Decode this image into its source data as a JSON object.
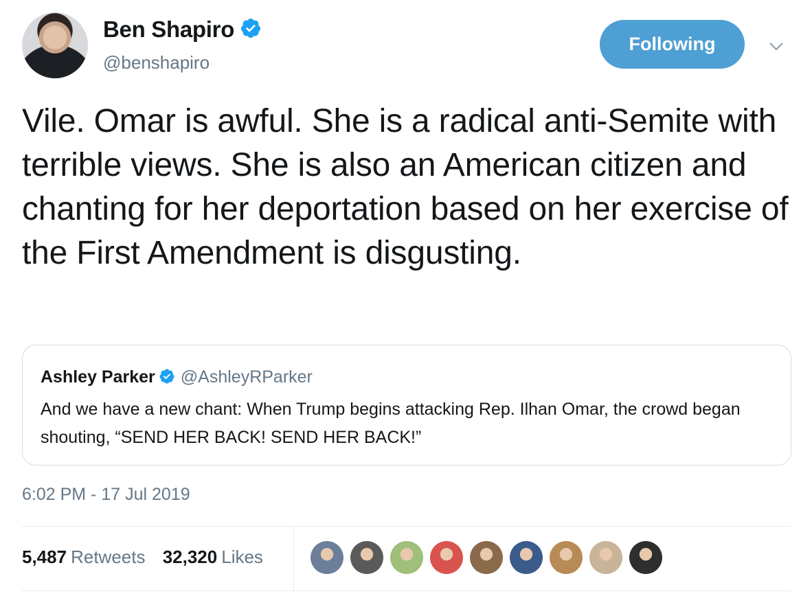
{
  "author": {
    "name": "Ben Shapiro",
    "handle": "@benshapiro",
    "verified": true
  },
  "follow_button": {
    "label": "Following",
    "color": "#4e9fd3"
  },
  "tweet": {
    "text": "Vile. Omar is awful. She is a radical anti-Semite with terrible views. She is also an American citizen and chanting for her deportation based on her exercise of the First Amendment is disgusting."
  },
  "quoted_tweet": {
    "name": "Ashley Parker",
    "handle": "@AshleyRParker",
    "verified": true,
    "text": "And we have a new chant: When Trump begins attacking Rep. Ilhan Omar, the crowd began shouting, “SEND HER BACK! SEND HER BACK!”"
  },
  "timestamp": "6:02 PM - 17 Jul 2019",
  "stats": {
    "retweets_count": "5,487",
    "retweets_label": "Retweets",
    "likes_count": "32,320",
    "likes_label": "Likes"
  },
  "likers": [
    {
      "icon": "avatar",
      "color": "#6b7f9a"
    },
    {
      "icon": "avatar",
      "color": "#5a5a5a"
    },
    {
      "icon": "avatar",
      "color": "#9fbf7a"
    },
    {
      "icon": "avatar",
      "color": "#d9534f"
    },
    {
      "icon": "avatar",
      "color": "#8a6a4a"
    },
    {
      "icon": "avatar",
      "color": "#3b5b8c"
    },
    {
      "icon": "avatar",
      "color": "#b88a55"
    },
    {
      "icon": "avatar",
      "color": "#c9b49a"
    },
    {
      "icon": "avatar",
      "color": "#2e2e2e"
    }
  ],
  "colors": {
    "text": "#14171a",
    "secondary": "#657786",
    "verified": "#1da1f2",
    "border": "#d7dde3"
  }
}
